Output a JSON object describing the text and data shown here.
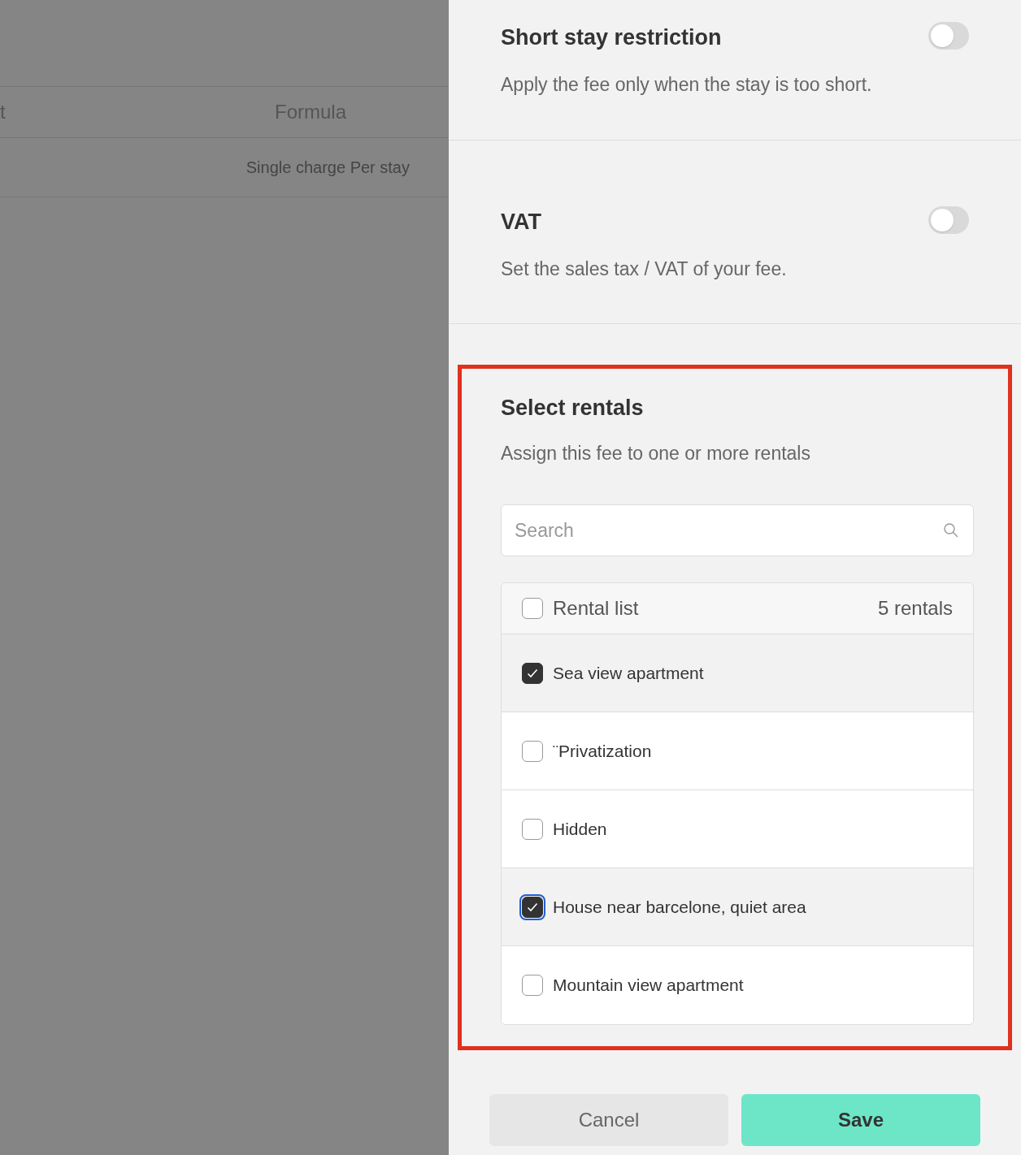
{
  "background_table": {
    "columns": [
      "t",
      "Formula"
    ],
    "rows": [
      {
        "column_2": "Single charge Per stay"
      }
    ]
  },
  "settings": [
    {
      "title": "Short stay restriction",
      "description": "Apply the fee only when the stay is too short.",
      "on": false
    },
    {
      "title": "VAT",
      "description": "Set the sales tax / VAT of your fee.",
      "on": false
    }
  ],
  "rentals_section": {
    "highlighted": true,
    "title": "Select rentals",
    "description": "Assign this fee to one or more rentals",
    "search": {
      "placeholder": "Search"
    },
    "list_header": {
      "label": "Rental list",
      "count": "5 rentals",
      "checked": false
    },
    "rentals": [
      {
        "name": "Sea view apartment",
        "checked": true,
        "focused": false
      },
      {
        "name": "¨Privatization",
        "checked": false,
        "focused": false
      },
      {
        "name": "Hidden",
        "checked": false,
        "focused": false
      },
      {
        "name": "House near barcelone, quiet area",
        "checked": true,
        "focused": true
      },
      {
        "name": "Mountain view apartment",
        "checked": false,
        "focused": false
      }
    ]
  },
  "buttons": {
    "cancel": "Cancel",
    "save": "Save"
  }
}
